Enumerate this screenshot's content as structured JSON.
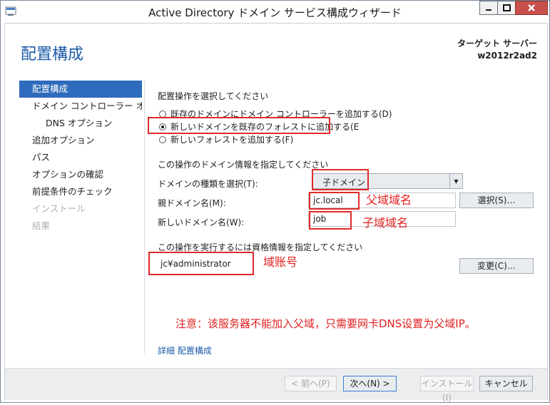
{
  "window": {
    "title": "Active Directory ドメイン サービス構成ウィザード",
    "controls": {
      "minimize": "minimize-icon",
      "maximize": "maximize-icon",
      "close": "close-icon"
    }
  },
  "header": {
    "page_title": "配置構成",
    "target_label": "ターゲット サーバー",
    "target_server": "w2012r2ad2"
  },
  "nav": {
    "items": [
      {
        "label": "配置構成",
        "state": "active"
      },
      {
        "label": "ドメイン コントローラー オプ…",
        "state": "normal"
      },
      {
        "label": "DNS オプション",
        "state": "sub"
      },
      {
        "label": "追加オプション",
        "state": "normal"
      },
      {
        "label": "パス",
        "state": "normal"
      },
      {
        "label": "オプションの確認",
        "state": "normal"
      },
      {
        "label": "前提条件のチェック",
        "state": "normal"
      },
      {
        "label": "インストール",
        "state": "disabled"
      },
      {
        "label": "結果",
        "state": "disabled"
      }
    ]
  },
  "deployment": {
    "section_label": "配置操作を選択してください",
    "options": [
      {
        "label": "既存のドメインにドメイン コントローラーを追加する(D)",
        "selected": false
      },
      {
        "label": "新しいドメインを既存のフォレストに追加する(E",
        "selected": true
      },
      {
        "label": "新しいフォレストを追加する(F)",
        "selected": false
      }
    ]
  },
  "domain_info": {
    "section_label": "この操作のドメイン情報を指定してください",
    "type_label": "ドメインの種類を選択(T):",
    "type_value": "子ドメイン",
    "parent_label": "親ドメイン名(M):",
    "parent_value": "jc.local",
    "select_button": "選択(S)…",
    "new_label": "新しいドメイン名(W):",
    "new_value": "job"
  },
  "credentials": {
    "section_label": "この操作を実行するには資格情報を指定してください",
    "value": "jc¥administrator",
    "change_button": "変更(C)…"
  },
  "annotations": {
    "parent_domain": "父域域名",
    "child_domain": "子域域名",
    "account": "域账号",
    "note": "注意：该服务器不能加入父域，只需要网卡DNS设置为父域IP。",
    "color": "#e02020"
  },
  "more_link": "詳細 配置構成",
  "footer": {
    "prev": "< 前へ(P)",
    "next": "次へ(N) >",
    "install": "インストール(I)",
    "cancel": "キャンセル"
  },
  "colors": {
    "accent": "#1d5ca8",
    "nav_active": "#2f6bbd",
    "close_button": "#c7504a"
  }
}
